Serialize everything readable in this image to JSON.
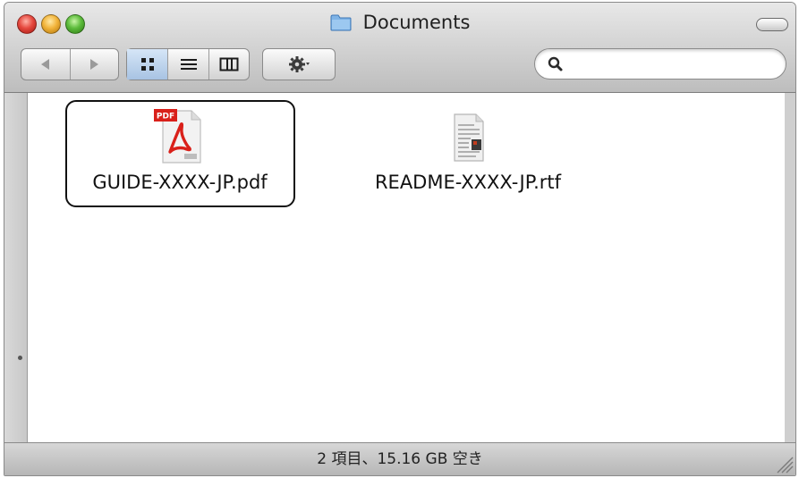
{
  "window": {
    "title": "Documents",
    "title_icon": "folder-icon"
  },
  "toolbar": {
    "nav": [
      "back-arrow-icon",
      "forward-arrow-icon"
    ],
    "views": [
      {
        "icon": "icon-view-icon",
        "active": true
      },
      {
        "icon": "list-view-icon",
        "active": false
      },
      {
        "icon": "column-view-icon",
        "active": false
      }
    ],
    "action_icon": "gear-icon",
    "search": {
      "value": "",
      "placeholder": ""
    }
  },
  "files": [
    {
      "name": "GUIDE-XXXX-JP.pdf",
      "icon": "pdf-file-icon",
      "selected": true,
      "badge": "PDF"
    },
    {
      "name": "README-XXXX-JP.rtf",
      "icon": "rtf-file-icon",
      "selected": false
    }
  ],
  "status": {
    "text": "2 項目、15.16 GB 空き"
  },
  "colors": {
    "pdf_red": "#d9201a",
    "selection_border": "#111111",
    "active_view": "#a8c3e3"
  }
}
